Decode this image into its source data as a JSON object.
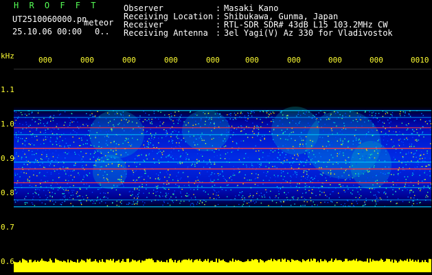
{
  "header": {
    "app_title": "H R O F F T",
    "filename": "UT2510060000.pn",
    "filename_suffix": "meteor",
    "date_time": "25.10.06 00:00",
    "count": "0..",
    "observer_label": "Observer",
    "observer_sep": ":",
    "observer_value": "Masaki Kano",
    "location_label": "Receiving Location",
    "location_sep": ":",
    "location_value": "Shibukawa, Gunma, Japan",
    "receiver_label": "Receiver",
    "receiver_sep": ":",
    "receiver_value": "RTL-SDR SDR# 43dB L15 103.2MHz CW",
    "antenna_label": "Receiving Antenna",
    "antenna_sep": ":",
    "antenna_value": "3el Yagi(V) Az 330 for Vladivostok"
  },
  "axis": {
    "y_unit": "kHz",
    "y_ticks": [
      "1.1",
      "1.0",
      "0.9",
      "0.8",
      "0.7",
      "0.6"
    ],
    "x_ticks": [
      "000",
      "000",
      "000",
      "000",
      "000",
      "000",
      "000",
      "000",
      "000",
      "0010"
    ]
  },
  "colors": {
    "background": "#000000",
    "text_green": "#55ff55",
    "text_white": "#ffffff",
    "text_yellow": "#ffff33",
    "spectrum_low": "#0000c8",
    "spectrum_mid": "#00c8c8",
    "spectrum_high": "#ff3a3a",
    "noise_bar": "#ffff00"
  }
}
